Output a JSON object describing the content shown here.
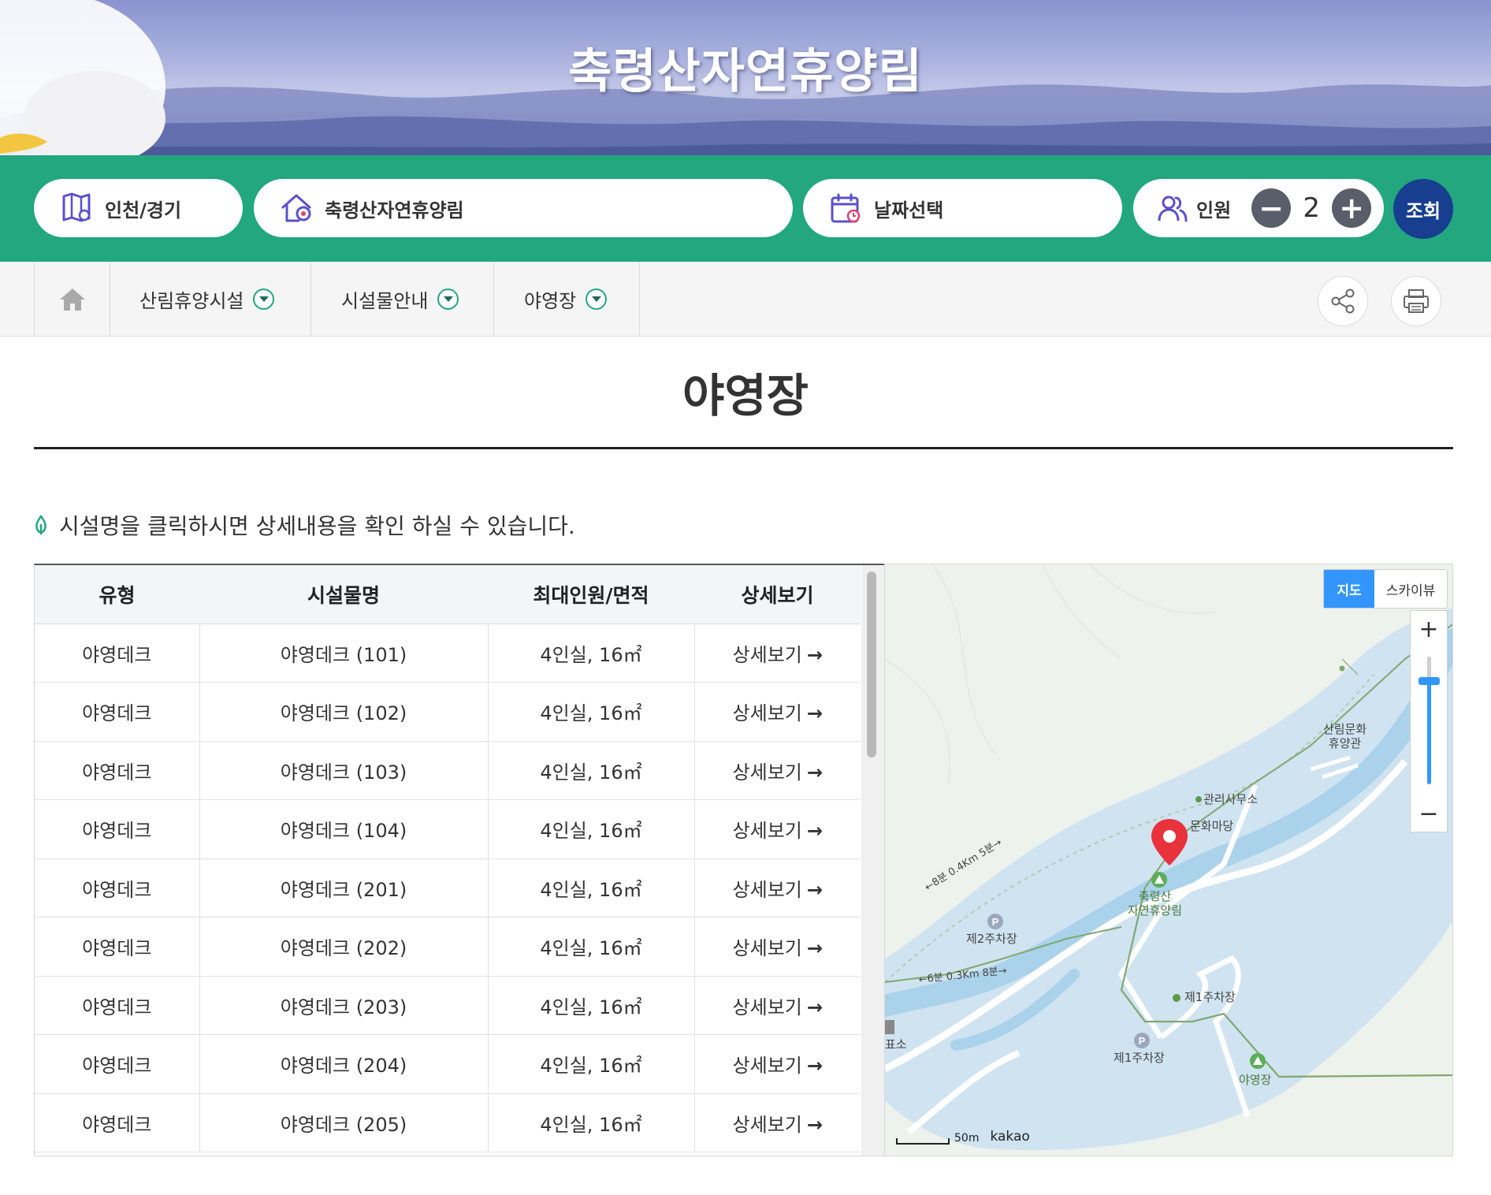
{
  "banner": {
    "title": "축령산자연휴양림"
  },
  "search": {
    "region": "인천/경기",
    "forest": "축령산자연휴양림",
    "date": "날짜선택",
    "people_label": "인원",
    "people_count": "2",
    "minus": "−",
    "plus": "+",
    "submit": "조회"
  },
  "breadcrumb": {
    "items": [
      {
        "label": "산림휴양시설"
      },
      {
        "label": "시설물안내"
      },
      {
        "label": "야영장"
      }
    ]
  },
  "page": {
    "title": "야영장",
    "notice": "시설명을 클릭하시면 상세내용을 확인 하실 수 있습니다."
  },
  "table": {
    "headers": [
      "유형",
      "시설물명",
      "최대인원/면적",
      "상세보기"
    ],
    "rows": [
      {
        "type": "야영데크",
        "name": "야영데크 (101)",
        "capacity": "4인실, 16㎡",
        "detail": "상세보기"
      },
      {
        "type": "야영데크",
        "name": "야영데크 (102)",
        "capacity": "4인실, 16㎡",
        "detail": "상세보기"
      },
      {
        "type": "야영데크",
        "name": "야영데크 (103)",
        "capacity": "4인실, 16㎡",
        "detail": "상세보기"
      },
      {
        "type": "야영데크",
        "name": "야영데크 (104)",
        "capacity": "4인실, 16㎡",
        "detail": "상세보기"
      },
      {
        "type": "야영데크",
        "name": "야영데크 (201)",
        "capacity": "4인실, 16㎡",
        "detail": "상세보기"
      },
      {
        "type": "야영데크",
        "name": "야영데크 (202)",
        "capacity": "4인실, 16㎡",
        "detail": "상세보기"
      },
      {
        "type": "야영데크",
        "name": "야영데크 (203)",
        "capacity": "4인실, 16㎡",
        "detail": "상세보기"
      },
      {
        "type": "야영데크",
        "name": "야영데크 (204)",
        "capacity": "4인실, 16㎡",
        "detail": "상세보기"
      },
      {
        "type": "야영데크",
        "name": "야영데크 (205)",
        "capacity": "4인실, 16㎡",
        "detail": "상세보기"
      }
    ]
  },
  "map": {
    "toggle_map": "지도",
    "toggle_sky": "스카이뷰",
    "zoom_in": "+",
    "zoom_out": "−",
    "scale": "50m",
    "brand": "kakao",
    "labels": {
      "culture_hall": "산림문화\n휴양관",
      "office": "관리사무소",
      "plaza": "문화마당",
      "forest": "축령산\n자연휴양림",
      "parking2": "제2주차장",
      "parking1_top": "제1주차장",
      "parking1_bottom": "제1주차장",
      "campsite": "야영장",
      "route1": "←8분 0.4Km 5분→",
      "route2": "←6분 0.3Km 8분→",
      "edge": "표소"
    }
  },
  "colors": {
    "green": "#22a77f",
    "navy": "#173e8f",
    "map_blue": "#3396ff",
    "pin": "#e8323c"
  }
}
